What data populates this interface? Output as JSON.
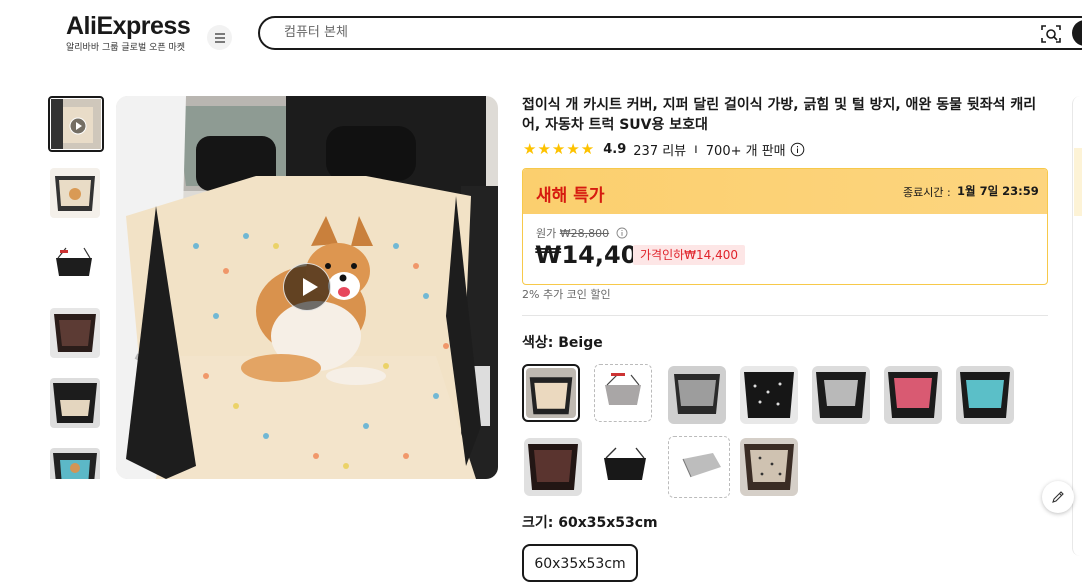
{
  "header": {
    "logo_text": "AliExpress",
    "logo_tagline": "알리바바 그룹 글로벌 오픈 마켓",
    "search_placeholder": "컴퓨터 본체",
    "icons": [
      "menu-icon",
      "camera-search-icon",
      "search-icon"
    ]
  },
  "gallery": {
    "thumbnails": [
      "video-thumbnail",
      "beige-seat-cover",
      "foldable-basket",
      "brown-seat-cover",
      "black-seat-cover",
      "teal-seat-cover"
    ],
    "main_media": "corgi-on-beige-seat-cover-video"
  },
  "product": {
    "title": "접이식 개 카시트 커버, 지퍼 달린 걸이식 가방, 긁힘 및 털 방지, 애완 동물 뒷좌석 캐리어, 자동차 트럭 SUV용 보호대",
    "stars": "★★★★★",
    "rating": "4.9",
    "reviews": "237 리뷰",
    "separator": "ı",
    "sold": "700+ 개 판매",
    "rating_value": 4.9
  },
  "deal": {
    "title": "새해 특가",
    "end_label": "종료시간 :",
    "end_time": "1월 7일 23:59",
    "original_label": "원가",
    "original_price": "₩28,800",
    "price": "₩14,400",
    "discount": "가격인하₩14,400",
    "coin_note": "2% 추가 코인 할인",
    "colors": {
      "header": "#fdcd6a",
      "title": "#d61b0f",
      "discount_bg": "#fde6e6",
      "discount_text": "#e0232b"
    }
  },
  "options": {
    "color_label": "색상: Beige",
    "colors": [
      "Beige",
      "Basket-Grey",
      "Grey",
      "Black-Dot",
      "Black-Grey",
      "Pink",
      "Teal",
      "Brown",
      "Black-Basket",
      "Grey-Basket",
      "Brown-Dot"
    ],
    "selected_color": "Beige",
    "size_label": "크기: 60x35x53cm",
    "size_option": "60x35x53cm"
  }
}
